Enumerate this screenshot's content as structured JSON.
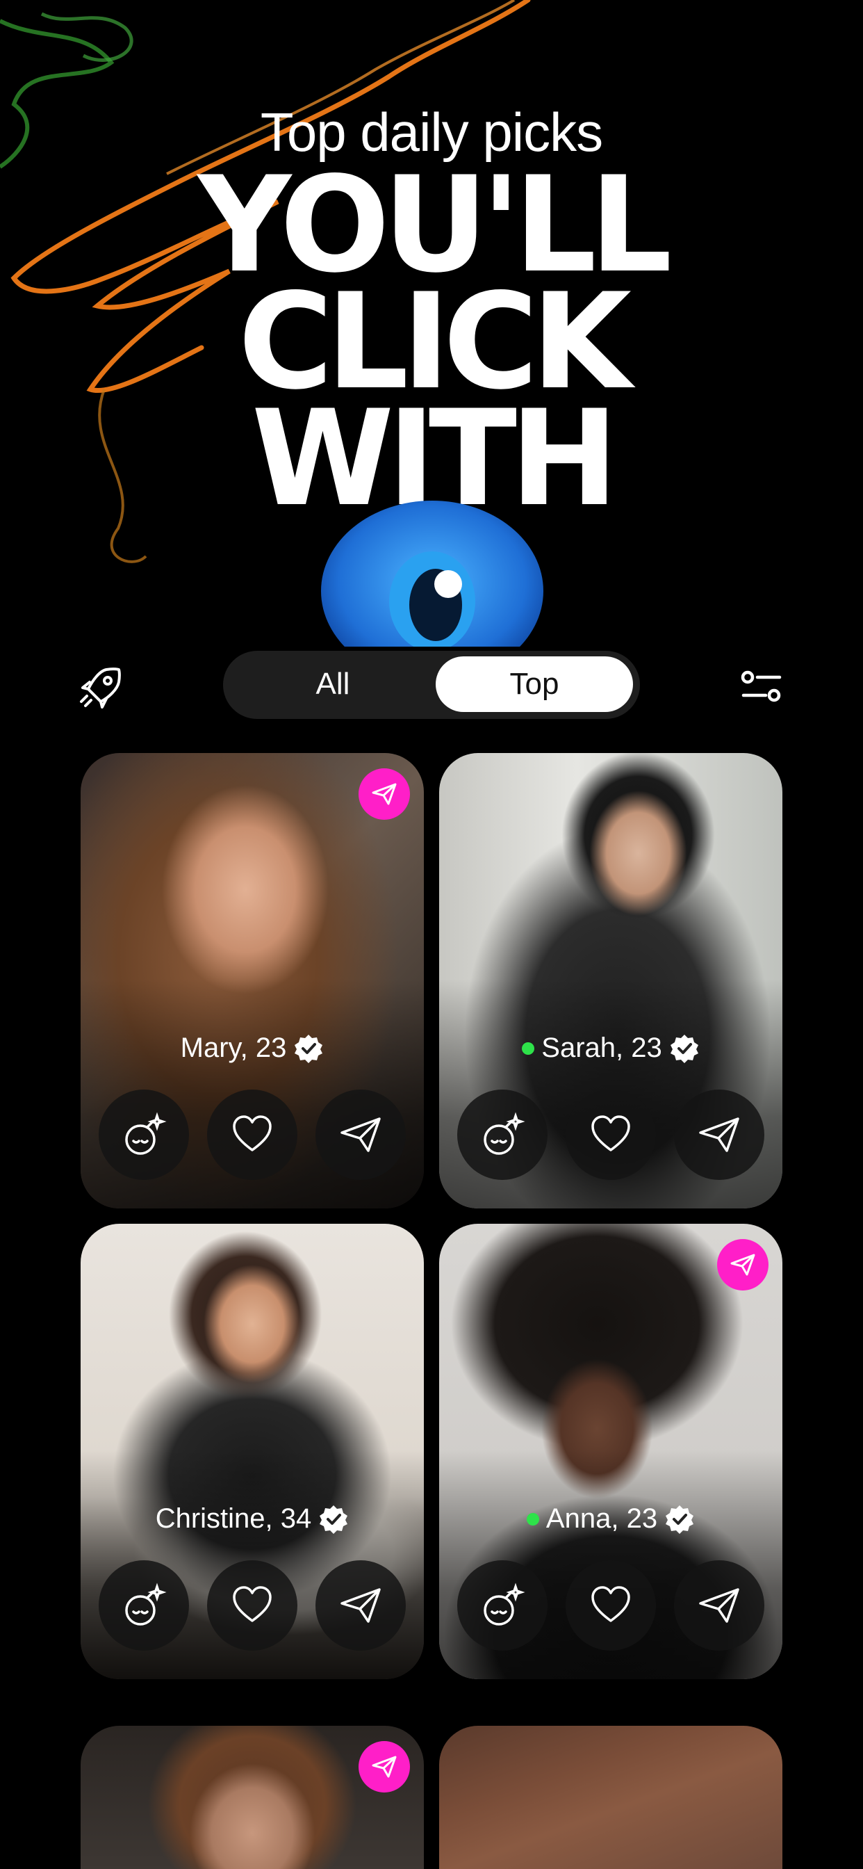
{
  "hero": {
    "subtitle": "Top daily picks",
    "headline_lines": [
      "YOU'LL",
      "CLICK",
      "WITH"
    ]
  },
  "tabs": {
    "all_label": "All",
    "top_label": "Top",
    "selected": "Top"
  },
  "icons": {
    "left": "rocket-icon",
    "right": "filter-icon",
    "card_badge": "paper-plane-icon",
    "actions": [
      "bomb-icon",
      "heart-icon",
      "paper-plane-icon"
    ]
  },
  "colors": {
    "badge": "#ff1fc8",
    "online": "#2ee24a",
    "segment_bg": "#1e1e1e"
  },
  "cards": [
    {
      "name": "Mary, 23",
      "online": false,
      "verified": true,
      "badge": true
    },
    {
      "name": "Sarah, 23",
      "online": true,
      "verified": true,
      "badge": false
    },
    {
      "name": "Christine, 34",
      "online": false,
      "verified": true,
      "badge": false
    },
    {
      "name": "Anna, 23",
      "online": true,
      "verified": true,
      "badge": true
    },
    {
      "name": "",
      "online": false,
      "verified": false,
      "badge": true
    },
    {
      "name": "",
      "online": false,
      "verified": false,
      "badge": false
    }
  ]
}
